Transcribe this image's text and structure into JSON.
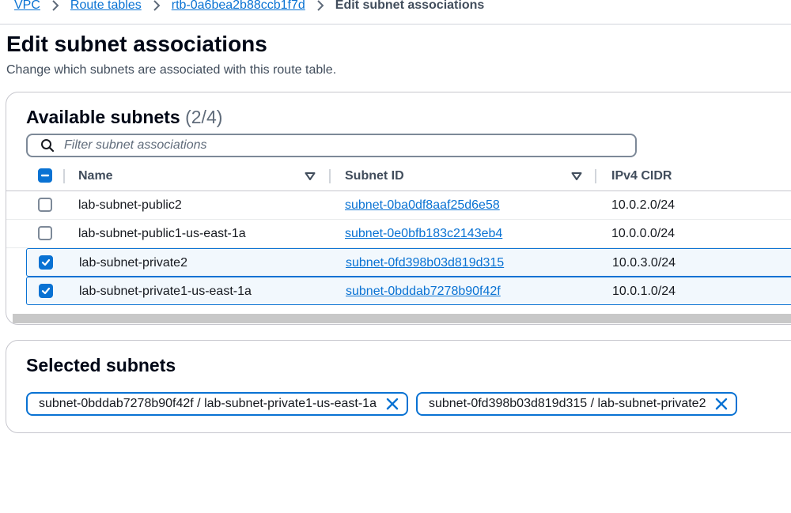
{
  "breadcrumb": {
    "items": [
      "VPC",
      "Route tables",
      "rtb-0a6bea2b88ccb1f7d"
    ],
    "current": "Edit subnet associations"
  },
  "page": {
    "title": "Edit subnet associations",
    "description": "Change which subnets are associated with this route table."
  },
  "available": {
    "title": "Available subnets",
    "count": "(2/4)",
    "filter_placeholder": "Filter subnet associations",
    "columns": {
      "name": "Name",
      "subnet_id": "Subnet ID",
      "cidr": "IPv4 CIDR"
    },
    "rows": [
      {
        "name": "lab-subnet-public2",
        "subnet_id": "subnet-0ba0df8aaf25d6e58",
        "cidr": "10.0.2.0/24",
        "checked": false
      },
      {
        "name": "lab-subnet-public1-us-east-1a",
        "subnet_id": "subnet-0e0bfb183c2143eb4",
        "cidr": "10.0.0.0/24",
        "checked": false
      },
      {
        "name": "lab-subnet-private2",
        "subnet_id": "subnet-0fd398b03d819d315",
        "cidr": "10.0.3.0/24",
        "checked": true
      },
      {
        "name": "lab-subnet-private1-us-east-1a",
        "subnet_id": "subnet-0bddab7278b90f42f",
        "cidr": "10.0.1.0/24",
        "checked": true
      }
    ]
  },
  "selected": {
    "title": "Selected subnets",
    "tokens": [
      "subnet-0bddab7278b90f42f / lab-subnet-private1-us-east-1a",
      "subnet-0fd398b03d819d315 / lab-subnet-private2"
    ]
  },
  "colors": {
    "link": "#0972d3",
    "selected_bg": "#f2f8fd"
  }
}
